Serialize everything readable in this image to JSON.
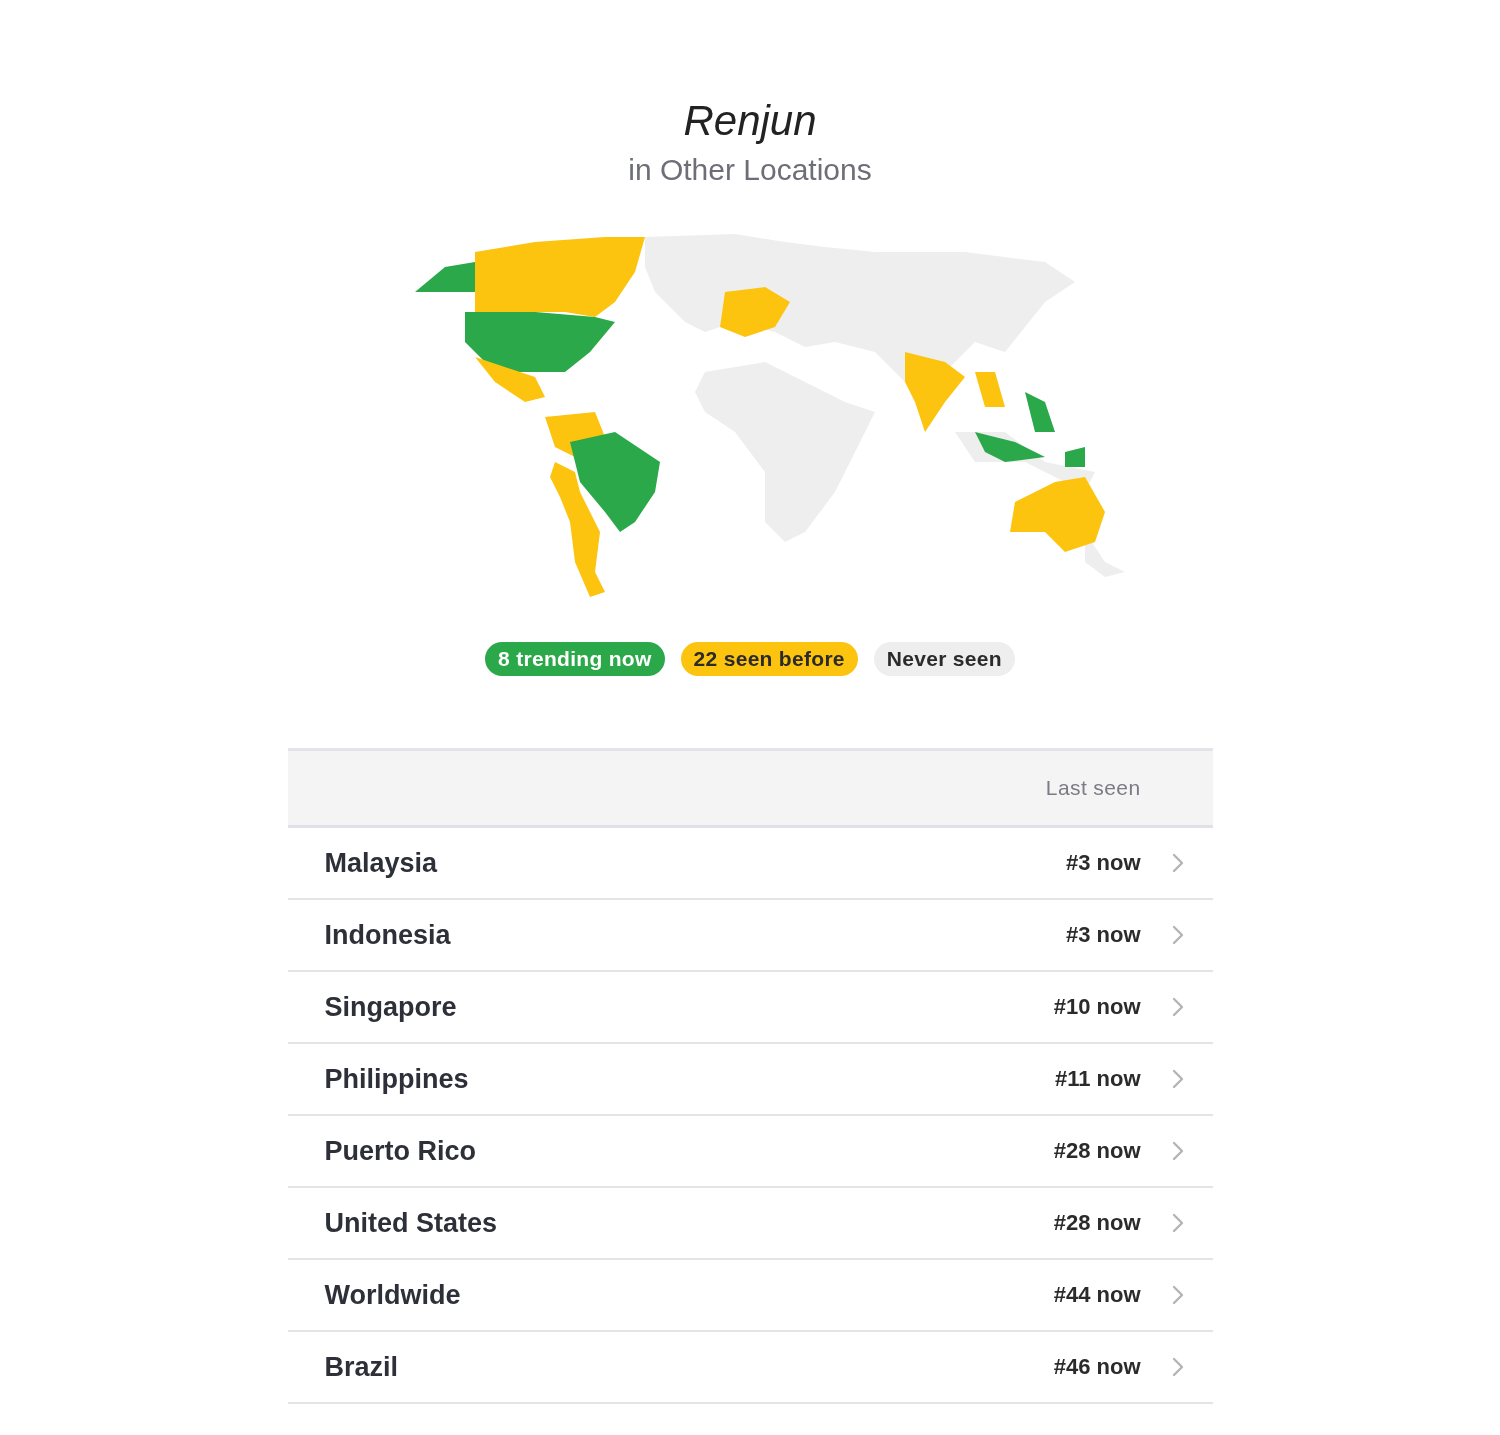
{
  "header": {
    "title": "Renjun",
    "subtitle": "in Other Locations"
  },
  "legend": [
    {
      "kind": "trending",
      "label": "8 trending now",
      "color": "#2aa84a"
    },
    {
      "kind": "seen",
      "label": "22 seen before",
      "color": "#fcc30f"
    },
    {
      "kind": "never",
      "label": "Never seen",
      "color": "#eeeeee"
    }
  ],
  "table": {
    "columns": [
      "Last seen"
    ],
    "rows": [
      {
        "country": "Malaysia",
        "last_seen": "#3 now"
      },
      {
        "country": "Indonesia",
        "last_seen": "#3 now"
      },
      {
        "country": "Singapore",
        "last_seen": "#10 now"
      },
      {
        "country": "Philippines",
        "last_seen": "#11 now"
      },
      {
        "country": "Puerto Rico",
        "last_seen": "#28 now"
      },
      {
        "country": "United States",
        "last_seen": "#28 now"
      },
      {
        "country": "Worldwide",
        "last_seen": "#44 now"
      },
      {
        "country": "Brazil",
        "last_seen": "#46 now"
      }
    ]
  }
}
